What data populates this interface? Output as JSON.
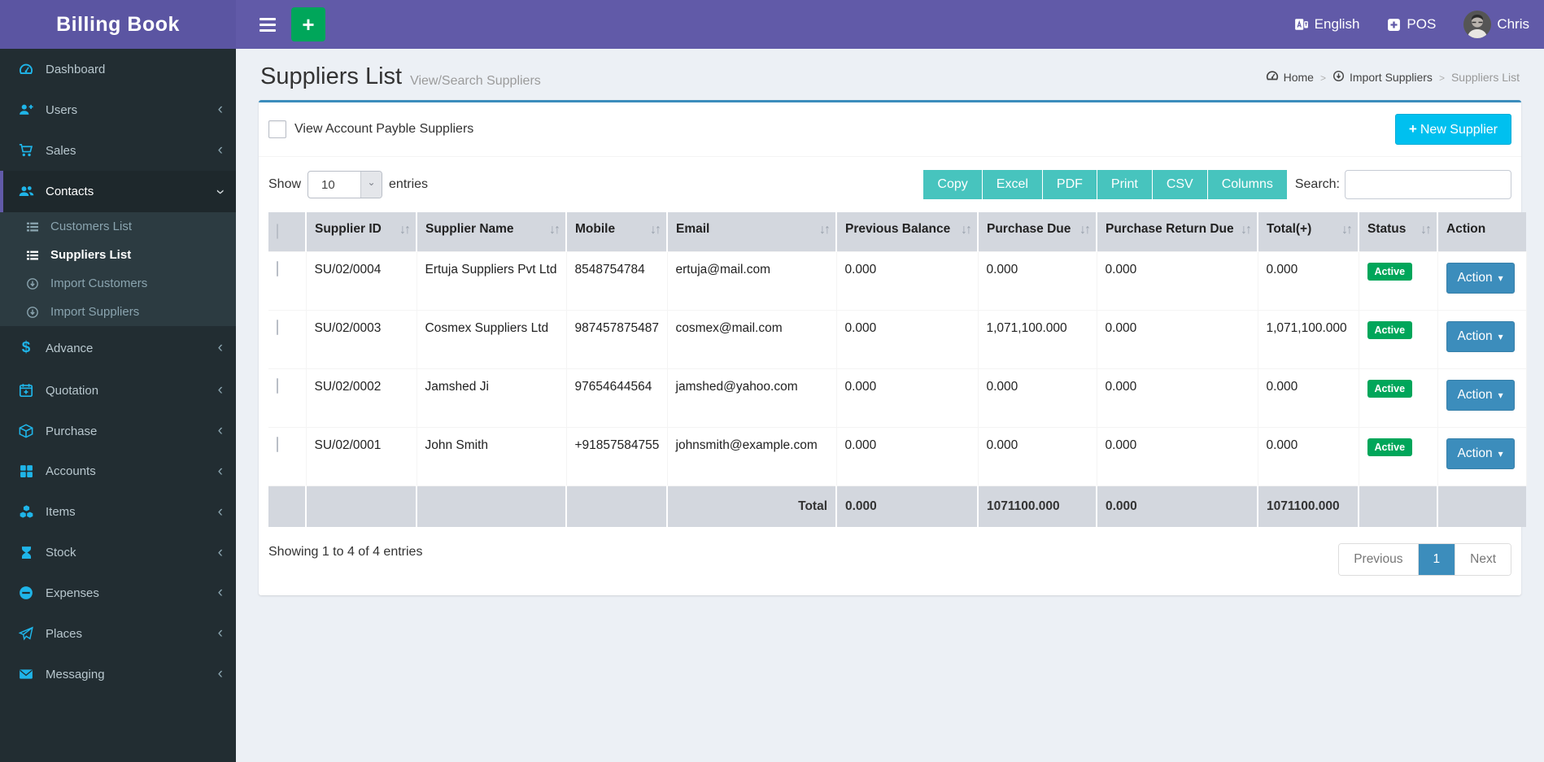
{
  "brand": {
    "title": "Billing Book"
  },
  "navbar": {
    "language": "English",
    "pos": "POS",
    "user": "Chris"
  },
  "sidebar": {
    "items": [
      "Dashboard",
      "Users",
      "Sales",
      "Contacts",
      "Advance",
      "Quotation",
      "Purchase",
      "Accounts",
      "Items",
      "Stock",
      "Expenses",
      "Places",
      "Messaging"
    ],
    "contacts_submenu": [
      "Customers List",
      "Suppliers List",
      "Import Customers",
      "Import Suppliers"
    ]
  },
  "page": {
    "title": "Suppliers List",
    "subtitle": "View/Search Suppliers",
    "breadcrumb": [
      "Home",
      "Import Suppliers",
      "Suppliers List"
    ]
  },
  "toolbar": {
    "payble_label": "View Account Payble Suppliers",
    "new_supplier_label": "New Supplier",
    "show_label": "Show",
    "page_length": "10",
    "entries_label": "entries",
    "export": [
      "Copy",
      "Excel",
      "PDF",
      "Print",
      "CSV",
      "Columns"
    ],
    "search_label": "Search:",
    "search_value": ""
  },
  "table": {
    "columns": [
      "Supplier ID",
      "Supplier Name",
      "Mobile",
      "Email",
      "Previous Balance",
      "Purchase Due",
      "Purchase Return Due",
      "Total(+)",
      "Status",
      "Action"
    ],
    "action_label": "Action",
    "rows": [
      {
        "id": "SU/02/0004",
        "name": "Ertuja Suppliers Pvt Ltd",
        "mobile": "8548754784",
        "email": "ertuja@mail.com",
        "prev_balance": "0.000",
        "purchase_due": "0.000",
        "purchase_return_due": "0.000",
        "total": "0.000",
        "status": "Active"
      },
      {
        "id": "SU/02/0003",
        "name": "Cosmex Suppliers Ltd",
        "mobile": "987457875487",
        "email": "cosmex@mail.com",
        "prev_balance": "0.000",
        "purchase_due": "1,071,100.000",
        "purchase_return_due": "0.000",
        "total": "1,071,100.000",
        "status": "Active"
      },
      {
        "id": "SU/02/0002",
        "name": "Jamshed Ji",
        "mobile": "97654644564",
        "email": "jamshed@yahoo.com",
        "prev_balance": "0.000",
        "purchase_due": "0.000",
        "purchase_return_due": "0.000",
        "total": "0.000",
        "status": "Active"
      },
      {
        "id": "SU/02/0001",
        "name": "John Smith",
        "mobile": "+91857584755",
        "email": "johnsmith@example.com",
        "prev_balance": "0.000",
        "purchase_due": "0.000",
        "purchase_return_due": "0.000",
        "total": "0.000",
        "status": "Active"
      }
    ],
    "footer": {
      "label": "Total",
      "prev_balance": "0.000",
      "purchase_due": "1071100.000",
      "purchase_return_due": "0.000",
      "total": "1071100.000"
    },
    "summary": "Showing 1 to 4 of 4 entries"
  },
  "pagination": {
    "previous": "Previous",
    "current": "1",
    "next": "Next"
  },
  "colors": {
    "navbar_purple": "#615aa8",
    "sidebar_dark": "#222d32",
    "icon_blue": "#1fb5e9",
    "accent_blue": "#3c8dbc",
    "info_cyan": "#00c0ef",
    "export_teal": "#47c4be",
    "success_green": "#00a65a",
    "table_header_grey": "#d3d7de",
    "content_bg": "#ecf0f5"
  }
}
